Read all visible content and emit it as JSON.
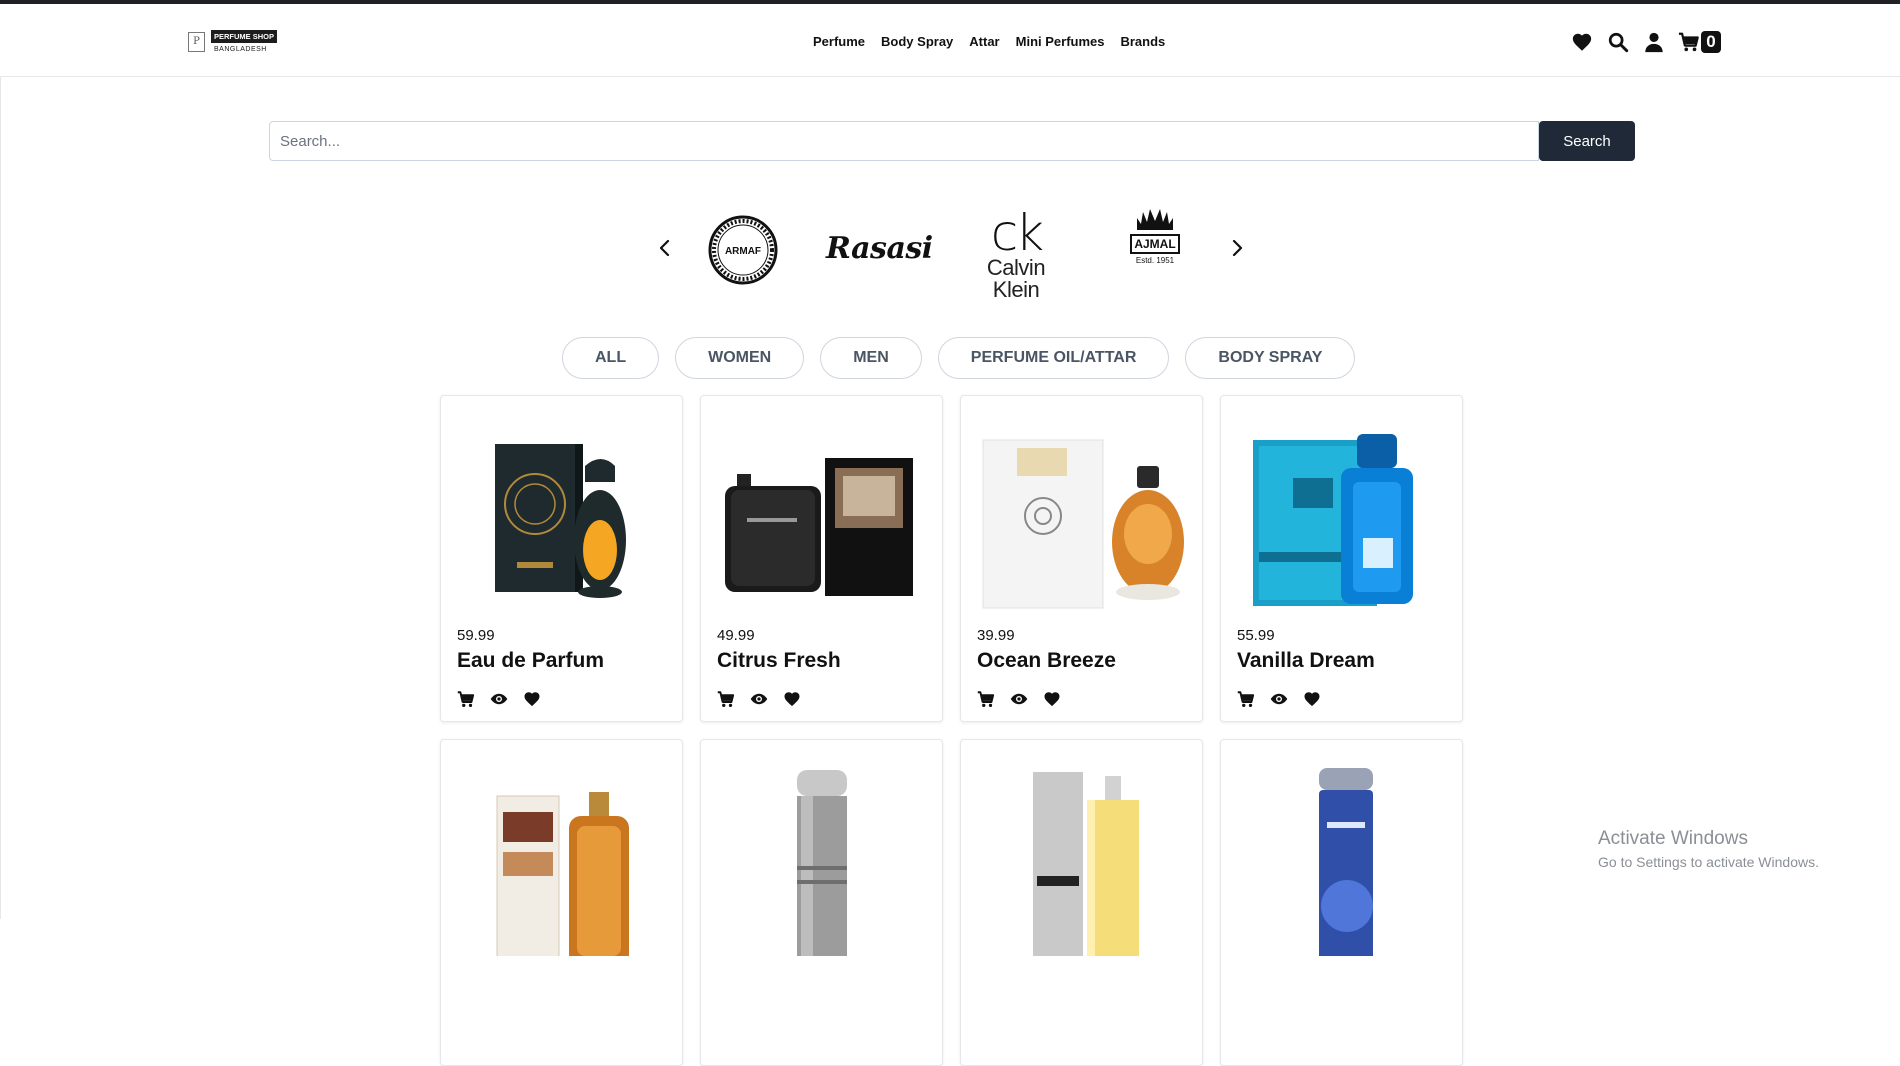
{
  "logo": {
    "box_text": "PERFUME SHOP",
    "sub_text": "BANGLADESH"
  },
  "nav": {
    "items": [
      "Perfume",
      "Body Spray",
      "Attar",
      "Mini Perfumes",
      "Brands"
    ]
  },
  "header_icons": [
    "heart-icon",
    "search-icon",
    "user-icon",
    "cart-icon"
  ],
  "cart": {
    "count": "0"
  },
  "search": {
    "placeholder": "Search...",
    "value": "",
    "button_label": "Search"
  },
  "brands": {
    "items": [
      {
        "name": "ARMAF"
      },
      {
        "name": "Rasasi"
      },
      {
        "mark": "ck",
        "name": "Calvin Klein"
      },
      {
        "name": "AJMAL",
        "tagline": "Estd. 1951"
      }
    ]
  },
  "filters": [
    "ALL",
    "WOMEN",
    "MEN",
    "PERFUME OIL/ATTAR",
    "BODY SPRAY"
  ],
  "products": [
    {
      "price": "59.99",
      "name": "Eau de Parfum"
    },
    {
      "price": "49.99",
      "name": "Citrus Fresh"
    },
    {
      "price": "39.99",
      "name": "Ocean Breeze"
    },
    {
      "price": "55.99",
      "name": "Vanilla Dream"
    },
    {
      "price": "",
      "name": ""
    },
    {
      "price": "",
      "name": ""
    },
    {
      "price": "",
      "name": ""
    },
    {
      "price": "",
      "name": ""
    }
  ],
  "product_actions": [
    "cart-icon",
    "eye-icon",
    "heart-icon"
  ],
  "watermark": {
    "title": "Activate Windows",
    "subtitle": "Go to Settings to activate Windows."
  },
  "colors": {
    "primary_dark": "#1f2937",
    "border": "#e5e7eb",
    "pill_text": "#4b5563"
  }
}
